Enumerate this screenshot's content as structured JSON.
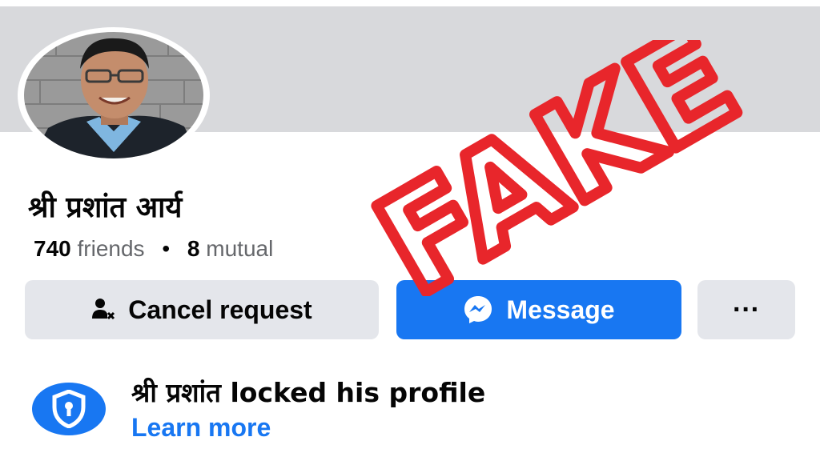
{
  "profile": {
    "name": "श्री प्रशांत आर्य",
    "friends_count": "740",
    "friends_label": "friends",
    "separator": "•",
    "mutual_count": "8",
    "mutual_label": "mutual"
  },
  "actions": {
    "cancel_label": "Cancel request",
    "message_label": "Message",
    "more_label": "···"
  },
  "lock_notice": {
    "text": "श्री प्रशांत locked his profile",
    "link": "Learn more"
  },
  "overlay": {
    "stamp_text": "FAKE",
    "color": "#e8262b"
  },
  "colors": {
    "brand": "#1877f2",
    "button_gray": "#e4e6eb",
    "cover": "#d8d9dc"
  },
  "icons": {
    "cancel": "person-x-icon",
    "message": "messenger-icon",
    "lock": "shield-lock-icon"
  }
}
